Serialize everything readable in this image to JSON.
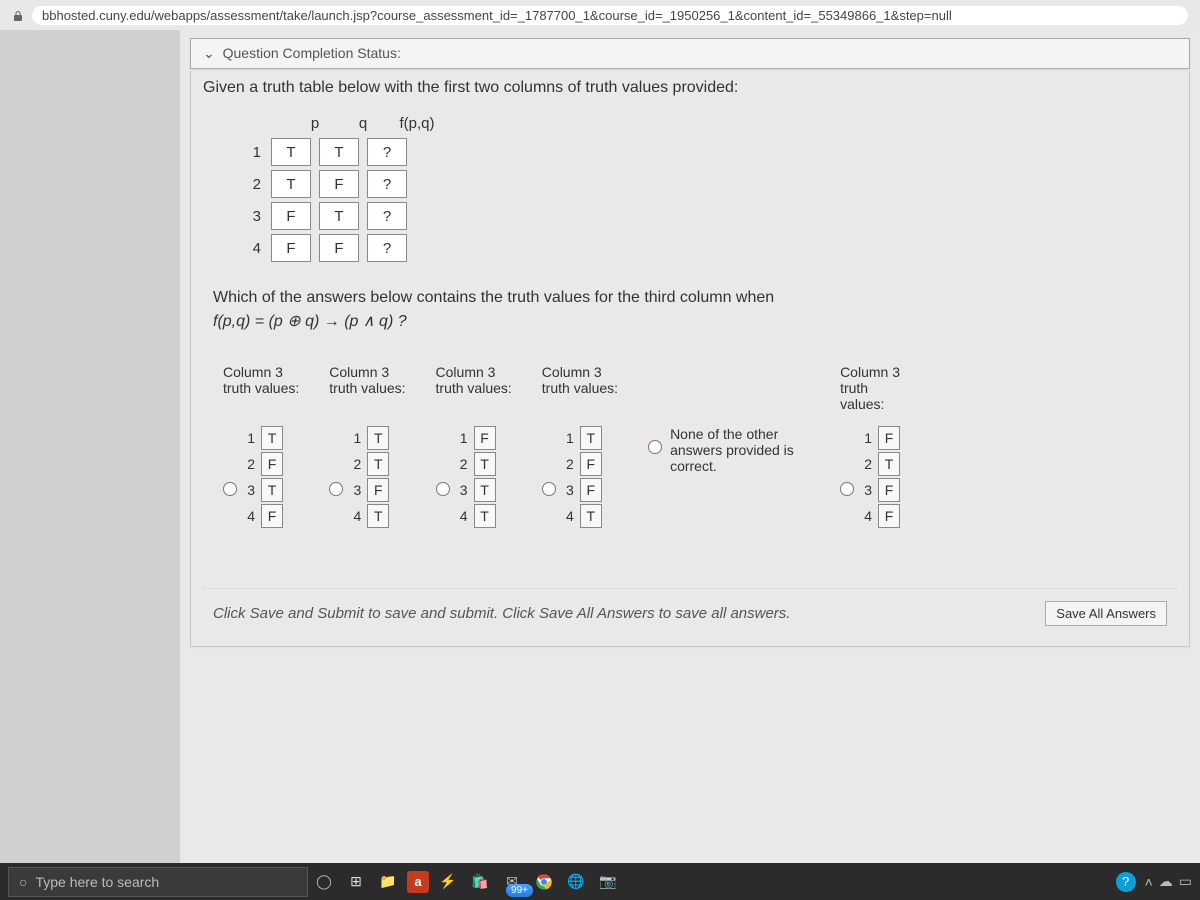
{
  "browser": {
    "url": "bbhosted.cuny.edu/webapps/assessment/take/launch.jsp?course_assessment_id=_1787700_1&course_id=_1950256_1&content_id=_55349866_1&step=null"
  },
  "status": {
    "label": "Question Completion Status:"
  },
  "prompt": {
    "intro": "Given a truth table below with the first two columns of truth values provided:",
    "headers": [
      "p",
      "q",
      "f(p,q)"
    ],
    "rows": [
      {
        "n": "1",
        "p": "T",
        "q": "T",
        "f": "?"
      },
      {
        "n": "2",
        "p": "T",
        "q": "F",
        "f": "?"
      },
      {
        "n": "3",
        "p": "F",
        "q": "T",
        "f": "?"
      },
      {
        "n": "4",
        "p": "F",
        "q": "F",
        "f": "?"
      }
    ],
    "question": "Which of the answers below contains  the truth values for the third column when",
    "formula": "f(p,q) = (p ⊕ q) → (p ∧ q) ?"
  },
  "options": [
    {
      "header": "Column 3\ntruth values:",
      "vals": [
        "T",
        "F",
        "T",
        "F"
      ]
    },
    {
      "header": "Column 3\ntruth values:",
      "vals": [
        "T",
        "T",
        "F",
        "T"
      ]
    },
    {
      "header": "Column 3\ntruth values:",
      "vals": [
        "F",
        "T",
        "T",
        "T"
      ]
    },
    {
      "header": "Column 3\ntruth values:",
      "vals": [
        "T",
        "F",
        "F",
        "T"
      ]
    },
    {
      "header": "",
      "none": "None of the other answers provided is correct."
    },
    {
      "header": "Column 3\ntruth\nvalues:",
      "vals": [
        "F",
        "T",
        "F",
        "F"
      ]
    }
  ],
  "footer": {
    "hint": "Click Save and Submit to save and submit. Click Save All Answers to save all answers.",
    "save": "Save All Answers"
  },
  "taskbar": {
    "search_placeholder": "Type here to search",
    "badge": "99+"
  }
}
